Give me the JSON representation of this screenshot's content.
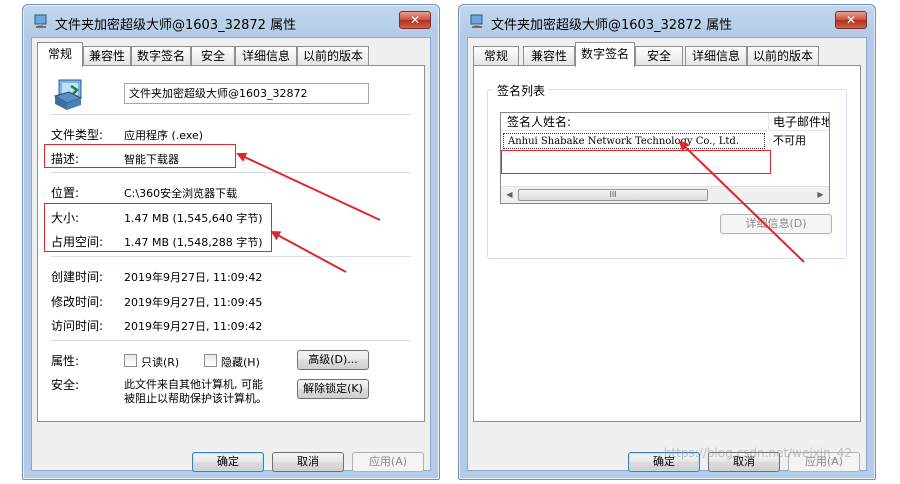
{
  "left_window": {
    "title": "文件夹加密超级大师@1603_32872 属性",
    "close_label": "✕",
    "tabs": [
      {
        "label": "常规",
        "active": true
      },
      {
        "label": "兼容性",
        "active": false
      },
      {
        "label": "数字签名",
        "active": false
      },
      {
        "label": "安全",
        "active": false
      },
      {
        "label": "详细信息",
        "active": false
      },
      {
        "label": "以前的版本",
        "active": false
      }
    ],
    "file_name": "文件夹加密超级大师@1603_32872",
    "file_type_label": "文件类型:",
    "file_type_value": "应用程序 (.exe)",
    "description_label": "描述:",
    "description_value": "智能下载器",
    "location_label": "位置:",
    "location_value": "C:\\360安全浏览器下载",
    "size_label": "大小:",
    "size_value": "1.47 MB (1,545,640 字节)",
    "disk_size_label": "占用空间:",
    "disk_size_value": "1.47 MB (1,548,288 字节)",
    "created_label": "创建时间:",
    "created_value": "2019年9月27日, 11:09:42",
    "modified_label": "修改时间:",
    "modified_value": "2019年9月27日, 11:09:45",
    "accessed_label": "访问时间:",
    "accessed_value": "2019年9月27日, 11:09:42",
    "attributes_label": "属性:",
    "readonly_label": "只读(R)",
    "hidden_label": "隐藏(H)",
    "advanced_button": "高级(D)...",
    "security_label": "安全:",
    "security_text_line1": "此文件来自其他计算机, 可能",
    "security_text_line2": "被阻止以帮助保护该计算机。",
    "unblock_button": "解除锁定(K)",
    "ok_button": "确定",
    "cancel_button": "取消",
    "apply_button": "应用(A)"
  },
  "right_window": {
    "title": "文件夹加密超级大师@1603_32872 属性",
    "close_label": "✕",
    "tabs": [
      {
        "label": "常规",
        "active": false
      },
      {
        "label": "兼容性",
        "active": false
      },
      {
        "label": "数字签名",
        "active": true
      },
      {
        "label": "安全",
        "active": false
      },
      {
        "label": "详细信息",
        "active": false
      },
      {
        "label": "以前的版本",
        "active": false
      }
    ],
    "signature_list_label": "签名列表",
    "columns": [
      "签名人姓名:",
      "电子邮件地"
    ],
    "rows": [
      {
        "signer": "Anhui Shabake Network Technology Co., Ltd.",
        "email": "不可用"
      }
    ],
    "scroll_thumb_grip": "III",
    "details_button": "详细信息(D)",
    "ok_button": "确定",
    "cancel_button": "取消",
    "apply_button": "应用(A)"
  },
  "watermark": "https://blog.csdn.net/weixin_42"
}
